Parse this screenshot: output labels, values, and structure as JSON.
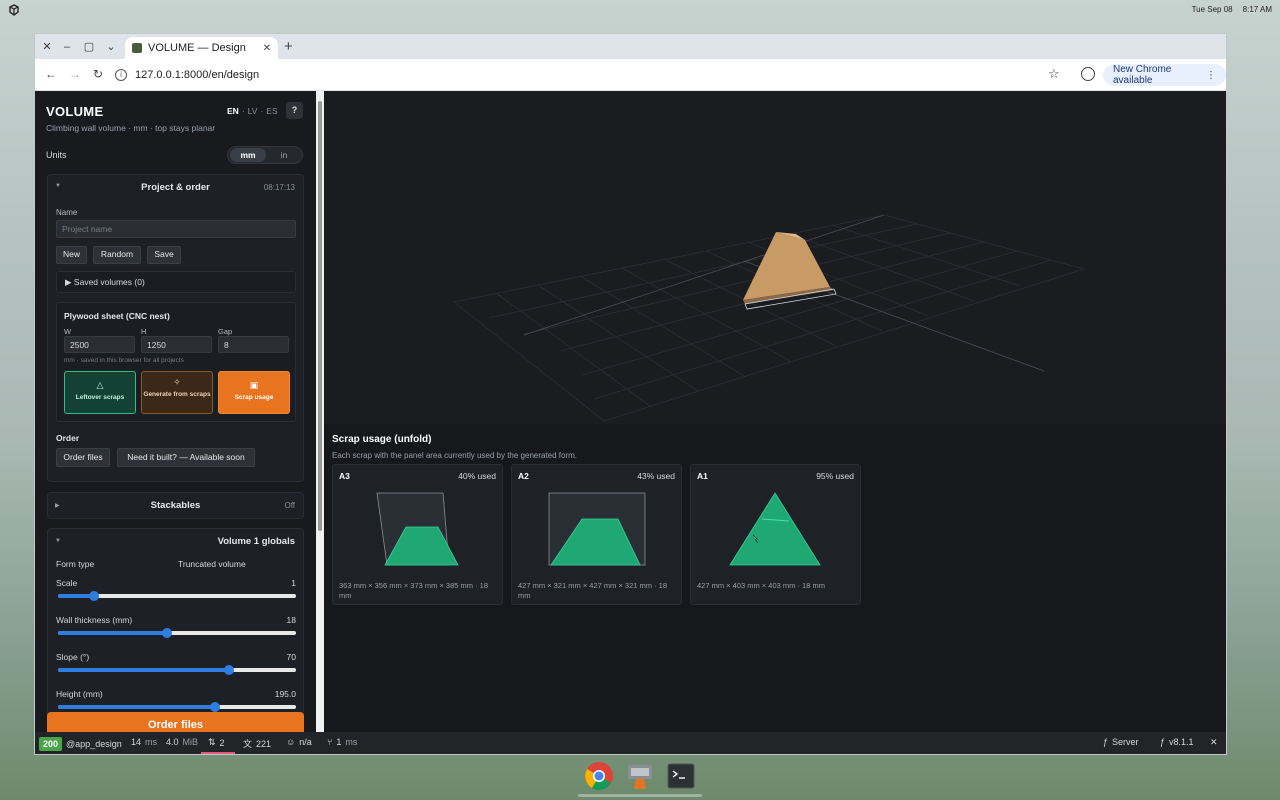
{
  "os": {
    "date": "Tue Sep 08",
    "time": "8:17 AM"
  },
  "browser": {
    "tab_title": "VOLUME — Design",
    "url": "127.0.0.1:8000/en/design",
    "update_label": "New Chrome available"
  },
  "app": {
    "brand": "VOLUME",
    "subtitle": "Climbing wall volume · mm · top stays planar",
    "langs": [
      "EN",
      "LV",
      "ES"
    ],
    "help": "?",
    "units_label": "Units",
    "units": [
      "mm",
      "in"
    ],
    "selected_unit": "mm"
  },
  "project": {
    "title": "Project & order",
    "time": "08:17:13",
    "name_label": "Name",
    "name_placeholder": "Project name",
    "btn_new": "New",
    "btn_random": "Random",
    "btn_save": "Save",
    "saved_volumes": "Saved volumes (0)",
    "plywood_title": "Plywood sheet (CNC nest)",
    "w_label": "W",
    "h_label": "H",
    "gap_label": "Gap",
    "w_value": "2500",
    "h_value": "1250",
    "gap_value": "8",
    "plywood_note": "mm · saved in this browser for all projects",
    "tile_leftover": "Leftover scraps",
    "tile_generate": "Generate from scraps",
    "tile_usage": "Scrap usage",
    "order_label": "Order",
    "btn_order_files": "Order files",
    "btn_need_built": "Need it built? — Available soon"
  },
  "stackables": {
    "title": "Stackables",
    "state": "Off"
  },
  "globals": {
    "title": "Volume 1 globals",
    "form_type_label": "Form type",
    "form_type_value": "Truncated volume",
    "sliders": [
      {
        "label": "Scale",
        "value": "1",
        "fraction": 0.15
      },
      {
        "label": "Wall thickness (mm)",
        "value": "18",
        "fraction": 0.46
      },
      {
        "label": "Slope (°)",
        "value": "70",
        "fraction": 0.72
      },
      {
        "label": "Height (mm)",
        "value": "195.0",
        "fraction": 0.66
      }
    ]
  },
  "order_files_button": "Order files",
  "scrap_usage": {
    "title": "Scrap usage (unfold)",
    "subtitle": "Each scrap with the panel area currently used by the generated form.",
    "items": [
      {
        "id": "A3",
        "used": "40% used",
        "dims": "363 mm × 356 mm × 373 mm × 385 mm · 18 mm"
      },
      {
        "id": "A2",
        "used": "43% used",
        "dims": "427 mm × 321 mm × 427 mm × 321 mm · 18 mm"
      },
      {
        "id": "A1",
        "used": "95% used",
        "dims": "427 mm × 403 mm × 403 mm · 18 mm"
      }
    ]
  },
  "devbar": {
    "status": "200",
    "route": "@app_design",
    "time": "14",
    "time_unit": "ms",
    "memory": "4.0",
    "memory_unit": "MiB",
    "requests": "2",
    "translations": "221",
    "user": "n/a",
    "twig": "1",
    "twig_unit": "ms",
    "server_label": "Server",
    "version": "v8.1.1"
  },
  "colors": {
    "accent_orange": "#e8741f",
    "scrap_green": "#2bbd84",
    "slider_blue": "#2f7de1",
    "volume_tan": "#c89a66"
  }
}
